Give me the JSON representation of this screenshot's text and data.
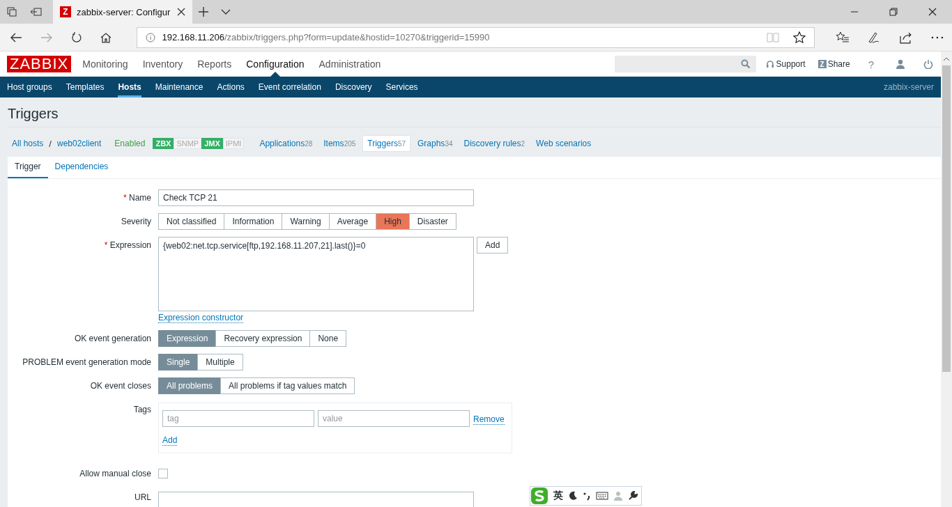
{
  "browser": {
    "tab_title": "zabbix-server: Configur",
    "tab_icon": "Z",
    "url_host": "192.168.11.206",
    "url_path": "/zabbix/triggers.php?form=update&hostid=10270&triggerid=15990"
  },
  "header": {
    "logo": "ZABBIX",
    "menu": [
      {
        "label": "Monitoring",
        "selected": false
      },
      {
        "label": "Inventory",
        "selected": false
      },
      {
        "label": "Reports",
        "selected": false
      },
      {
        "label": "Configuration",
        "selected": true
      },
      {
        "label": "Administration",
        "selected": false
      }
    ],
    "share_mark": "Z",
    "support": "Support",
    "share": "Share",
    "help": "?"
  },
  "subnav": {
    "items": [
      {
        "label": "Host groups",
        "selected": false
      },
      {
        "label": "Templates",
        "selected": false
      },
      {
        "label": "Hosts",
        "selected": true
      },
      {
        "label": "Maintenance",
        "selected": false
      },
      {
        "label": "Actions",
        "selected": false
      },
      {
        "label": "Event correlation",
        "selected": false
      },
      {
        "label": "Discovery",
        "selected": false
      },
      {
        "label": "Services",
        "selected": false
      }
    ],
    "server": "zabbix-server"
  },
  "title": "Triggers",
  "breadcrumbs": {
    "all_hosts": "All hosts",
    "separator": "/",
    "host": "web02client",
    "status": "Enabled",
    "availability": [
      {
        "label": "ZBX",
        "on": true
      },
      {
        "label": "SNMP",
        "on": false
      },
      {
        "label": "JMX",
        "on": true
      },
      {
        "label": "IPMI",
        "on": false
      }
    ],
    "links": [
      {
        "label": "Applications",
        "count": "28",
        "selected": false
      },
      {
        "label": "Items",
        "count": "205",
        "selected": false
      },
      {
        "label": "Triggers",
        "count": "57",
        "selected": true
      },
      {
        "label": "Graphs",
        "count": "34",
        "selected": false
      },
      {
        "label": "Discovery rules",
        "count": "2",
        "selected": false
      },
      {
        "label": "Web scenarios",
        "selected": false
      }
    ]
  },
  "form_tabs": [
    {
      "label": "Trigger",
      "selected": true
    },
    {
      "label": "Dependencies",
      "selected": false
    }
  ],
  "form": {
    "required_mark": "*",
    "name": {
      "label": "Name",
      "required": true,
      "value": "Check TCP 21"
    },
    "severity": {
      "label": "Severity",
      "options": [
        {
          "label": "Not classified",
          "selected": false
        },
        {
          "label": "Information",
          "selected": false
        },
        {
          "label": "Warning",
          "selected": false
        },
        {
          "label": "Average",
          "selected": false
        },
        {
          "label": "High",
          "selected": true
        },
        {
          "label": "Disaster",
          "selected": false
        }
      ]
    },
    "expression": {
      "label": "Expression",
      "required": true,
      "value": "{web02:net.tcp.service[ftp,192.168.11.207,21].last()}=0",
      "add_button": "Add",
      "constructor_link": "Expression constructor"
    },
    "ok_event_generation": {
      "label": "OK event generation",
      "options": [
        {
          "label": "Expression",
          "selected": true
        },
        {
          "label": "Recovery expression",
          "selected": false
        },
        {
          "label": "None",
          "selected": false
        }
      ]
    },
    "problem_mode": {
      "label": "PROBLEM event generation mode",
      "options": [
        {
          "label": "Single",
          "selected": true
        },
        {
          "label": "Multiple",
          "selected": false
        }
      ]
    },
    "ok_event_closes": {
      "label": "OK event closes",
      "options": [
        {
          "label": "All problems",
          "selected": true
        },
        {
          "label": "All problems if tag values match",
          "selected": false
        }
      ]
    },
    "tags": {
      "label": "Tags",
      "rows": [
        {
          "tag_placeholder": "tag",
          "value_placeholder": "value",
          "remove": "Remove"
        }
      ],
      "add": "Add"
    },
    "manual_close": {
      "label": "Allow manual close",
      "checked": false
    },
    "url": {
      "label": "URL"
    }
  },
  "ime": {
    "mode": "英"
  }
}
